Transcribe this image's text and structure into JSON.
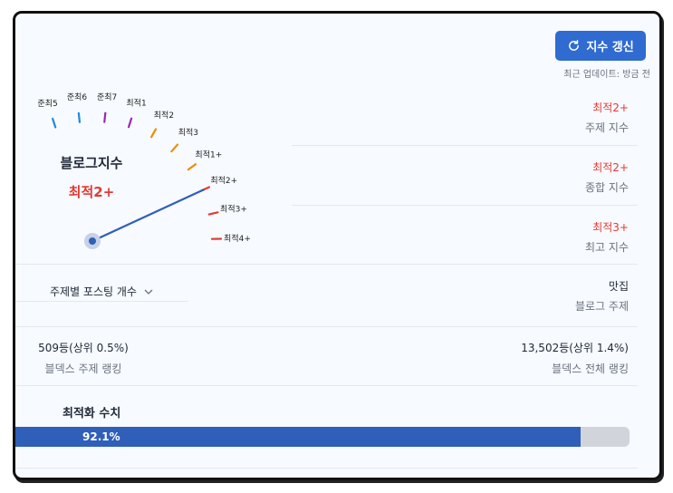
{
  "header": {
    "refresh_label": "지수 갱신",
    "update_note": "최근 업데이트: 방금 전"
  },
  "gauge": {
    "title": "블로그지수",
    "value": "최적2+",
    "levels": [
      "준최5",
      "준최6",
      "준최7",
      "최적1",
      "최적2",
      "최적3",
      "최적1+",
      "최적2+",
      "최적3+",
      "최적4+"
    ],
    "level_colors": [
      "#1e88e5",
      "#1e88e5",
      "#9c27b0",
      "#9c27b0",
      "#ef8c00",
      "#ef8c00",
      "#ef8c00",
      "#e53935",
      "#e53935",
      "#e53935"
    ],
    "needle_level": "최적2+"
  },
  "stats": [
    {
      "value": "최적2+",
      "label": "주제 지수"
    },
    {
      "value": "최적2+",
      "label": "종합 지수"
    },
    {
      "value": "최적3+",
      "label": "최고 지수"
    }
  ],
  "topic": {
    "dropdown_label": "주제별 포스팅 개수",
    "value": "맛집",
    "label": "블로그 주제"
  },
  "ranking": {
    "topic_value": "509등(상위 0.5%)",
    "topic_label": "블덱스 주제 랭킹",
    "total_value": "13,502등(상위 1.4%)",
    "total_label": "블덱스 전체 랭킹"
  },
  "optimization": {
    "title": "최적화 수치",
    "percent_label": "92.1%",
    "fraction": 0.921
  },
  "colors": {
    "accent": "#2f6bd0",
    "danger": "#e53935",
    "bar_fill": "#2f5fb8"
  }
}
